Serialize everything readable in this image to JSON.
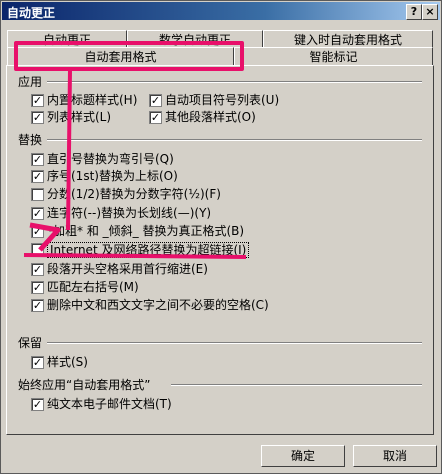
{
  "window": {
    "title": "自动更正",
    "help_button": "?",
    "close_button": "×"
  },
  "tabs": {
    "row1": [
      "自动更正",
      "数学自动更正",
      "键入时自动套用格式"
    ],
    "row2": [
      "自动套用格式",
      "智能标记"
    ]
  },
  "sections": {
    "apply": {
      "heading": "应用",
      "items": [
        {
          "label": "内置标题样式(H)",
          "checked": true
        },
        {
          "label": "自动项目符号列表(U)",
          "checked": true
        },
        {
          "label": "列表样式(L)",
          "checked": true
        },
        {
          "label": "其他段落样式(O)",
          "checked": true
        }
      ]
    },
    "replace": {
      "heading": "替换",
      "items": [
        {
          "label": "直引号替换为弯引号(Q)",
          "checked": true
        },
        {
          "label": "序号(1st)替换为上标(O)",
          "checked": true
        },
        {
          "label": "分数(1/2)替换为分数字符(½)(F)",
          "checked": false
        },
        {
          "label": "连字符(--)替换为长划线(—)(Y)",
          "checked": true
        },
        {
          "label": "*加粗* 和 _倾斜_ 替换为真正格式(B)",
          "checked": true
        },
        {
          "label": "Internet 及网络路径替换为超链接(I)",
          "checked": false
        },
        {
          "label": "段落开头空格采用首行缩进(E)",
          "checked": true
        },
        {
          "label": "匹配左右括号(M)",
          "checked": true
        },
        {
          "label": "删除中文和西文文字之间不必要的空格(C)",
          "checked": true
        }
      ]
    },
    "preserve": {
      "heading": "保留",
      "items": [
        {
          "label": "样式(S)",
          "checked": true
        }
      ]
    },
    "always": {
      "heading": "始终应用“自动套用格式”",
      "items": [
        {
          "label": "纯文本电子邮件文档(T)",
          "checked": true
        }
      ]
    }
  },
  "buttons": {
    "ok": "确定",
    "cancel": "取消"
  },
  "check_glyph": "✓",
  "annotation_color": "#e8106a"
}
